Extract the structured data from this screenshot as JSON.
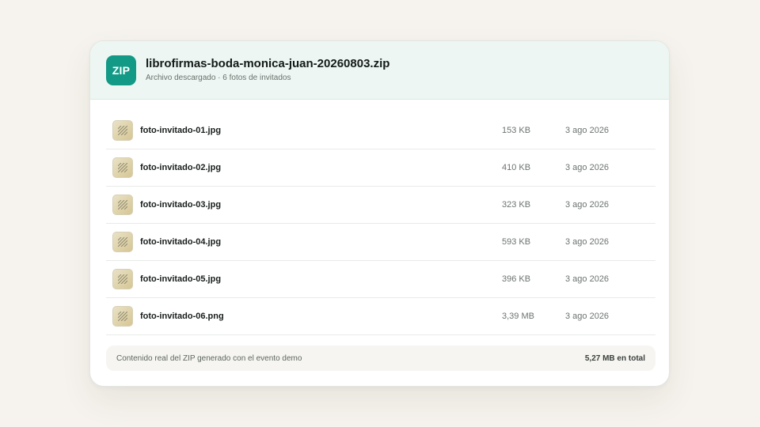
{
  "archive": {
    "badge": "ZIP",
    "name": "librofirmas-boda-monica-juan-20260803.zip",
    "subtitle": "Archivo descargado · 6 fotos de invitados",
    "badge_color": "#129a86"
  },
  "files": [
    {
      "name": "foto-invitado-01.jpg",
      "size": "153 KB",
      "date": "3 ago 2026",
      "icon": "image-thumbnail-icon"
    },
    {
      "name": "foto-invitado-02.jpg",
      "size": "410 KB",
      "date": "3 ago 2026",
      "icon": "image-thumbnail-icon"
    },
    {
      "name": "foto-invitado-03.jpg",
      "size": "323 KB",
      "date": "3 ago 2026",
      "icon": "image-thumbnail-icon"
    },
    {
      "name": "foto-invitado-04.jpg",
      "size": "593 KB",
      "date": "3 ago 2026",
      "icon": "image-thumbnail-icon"
    },
    {
      "name": "foto-invitado-05.jpg",
      "size": "396 KB",
      "date": "3 ago 2026",
      "icon": "image-thumbnail-icon"
    },
    {
      "name": "foto-invitado-06.png",
      "size": "3,39 MB",
      "date": "3 ago 2026",
      "icon": "image-thumbnail-icon"
    }
  ],
  "footer": {
    "note": "Contenido real del ZIP generado con el evento demo",
    "total": "5,27 MB en total"
  }
}
